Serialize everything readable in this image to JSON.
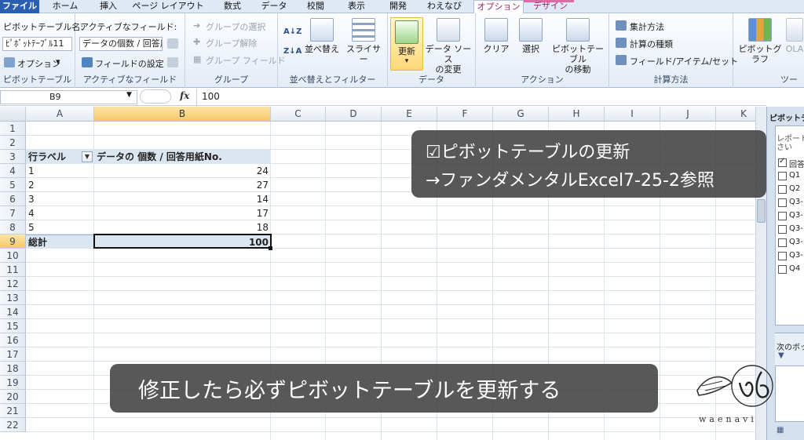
{
  "tabs": [
    "ファイル",
    "ホーム",
    "挿入",
    "ページ レイアウト",
    "数式",
    "データ",
    "校閲",
    "表示",
    "開発",
    "わえなび",
    "オプション",
    "デザイン"
  ],
  "ribbon": {
    "pivot_name_label": "ピボットテーブル名:",
    "pivot_name_value": "ﾋﾟﾎﾞｯﾄﾃｰﾌﾞﾙ11",
    "options_label": "オプション",
    "group_pivot": "ピボットテーブル",
    "active_field_label": "アクティブなフィールド:",
    "active_field_value": "データの個数 / 回答用",
    "field_settings_label": "フィールドの設定",
    "group_active_field": "アクティブなフィールド",
    "group_select_label": "グループの選択",
    "ungroup_label": "グループ解除",
    "group_field_label": "グループ フィールド",
    "group_group": "グループ",
    "sort_label": "並べ替え",
    "slicer_label": "スライサー",
    "group_sort": "並べ替えとフィルター",
    "refresh_label": "更新",
    "change_source_label_1": "データ ソース",
    "change_source_label_2": "の変更",
    "group_data": "データ",
    "clear_label": "クリア",
    "select_label": "選択",
    "move_label_1": "ピボットテーブル",
    "move_label_2": "の移動",
    "group_action": "アクション",
    "summarize_label": "集計方法",
    "show_values_label": "計算の種類",
    "fields_items_label": "フィールド/アイテム/セット",
    "group_calc": "計算方法",
    "pivot_chart_label": "ピボットグラフ",
    "olap_label": "OLA",
    "tools_label": "ツー"
  },
  "formula_bar": {
    "name_box": "B9",
    "fx": "fx",
    "value": "100"
  },
  "columns": [
    "A",
    "B",
    "C",
    "D",
    "E",
    "F",
    "G",
    "H",
    "I",
    "J",
    "K"
  ],
  "rows": [
    "1",
    "2",
    "3",
    "4",
    "5",
    "6",
    "7",
    "8",
    "9",
    "10",
    "11",
    "12",
    "13",
    "14",
    "15",
    "16",
    "17",
    "18",
    "19",
    "20",
    "21",
    "22"
  ],
  "pivot": {
    "header_a": "行ラベル",
    "header_b": "データの 個数 / 回答用紙No.",
    "rows": [
      {
        "label": "1",
        "value": "24"
      },
      {
        "label": "2",
        "value": "27"
      },
      {
        "label": "3",
        "value": "14"
      },
      {
        "label": "4",
        "value": "17"
      },
      {
        "label": "5",
        "value": "18"
      }
    ],
    "total_label": "総計",
    "total_value": "100"
  },
  "notes": {
    "top_line1": "☑ピボットテーブルの更新",
    "top_line2": "→ファンダメンタルExcel7-25-2参照",
    "bottom": "修正したら必ずピボットテーブルを更新する"
  },
  "watermark": "waenavi",
  "field_pane": {
    "title": "ピボットテ",
    "sub1": "レポート",
    "sub2": "さい",
    "checked_item": "回答",
    "items": [
      "Q1",
      "Q2",
      "Q3-",
      "Q3-",
      "Q3-",
      "Q3-",
      "Q3-",
      "Q4"
    ],
    "next_label": "次のボッ"
  }
}
